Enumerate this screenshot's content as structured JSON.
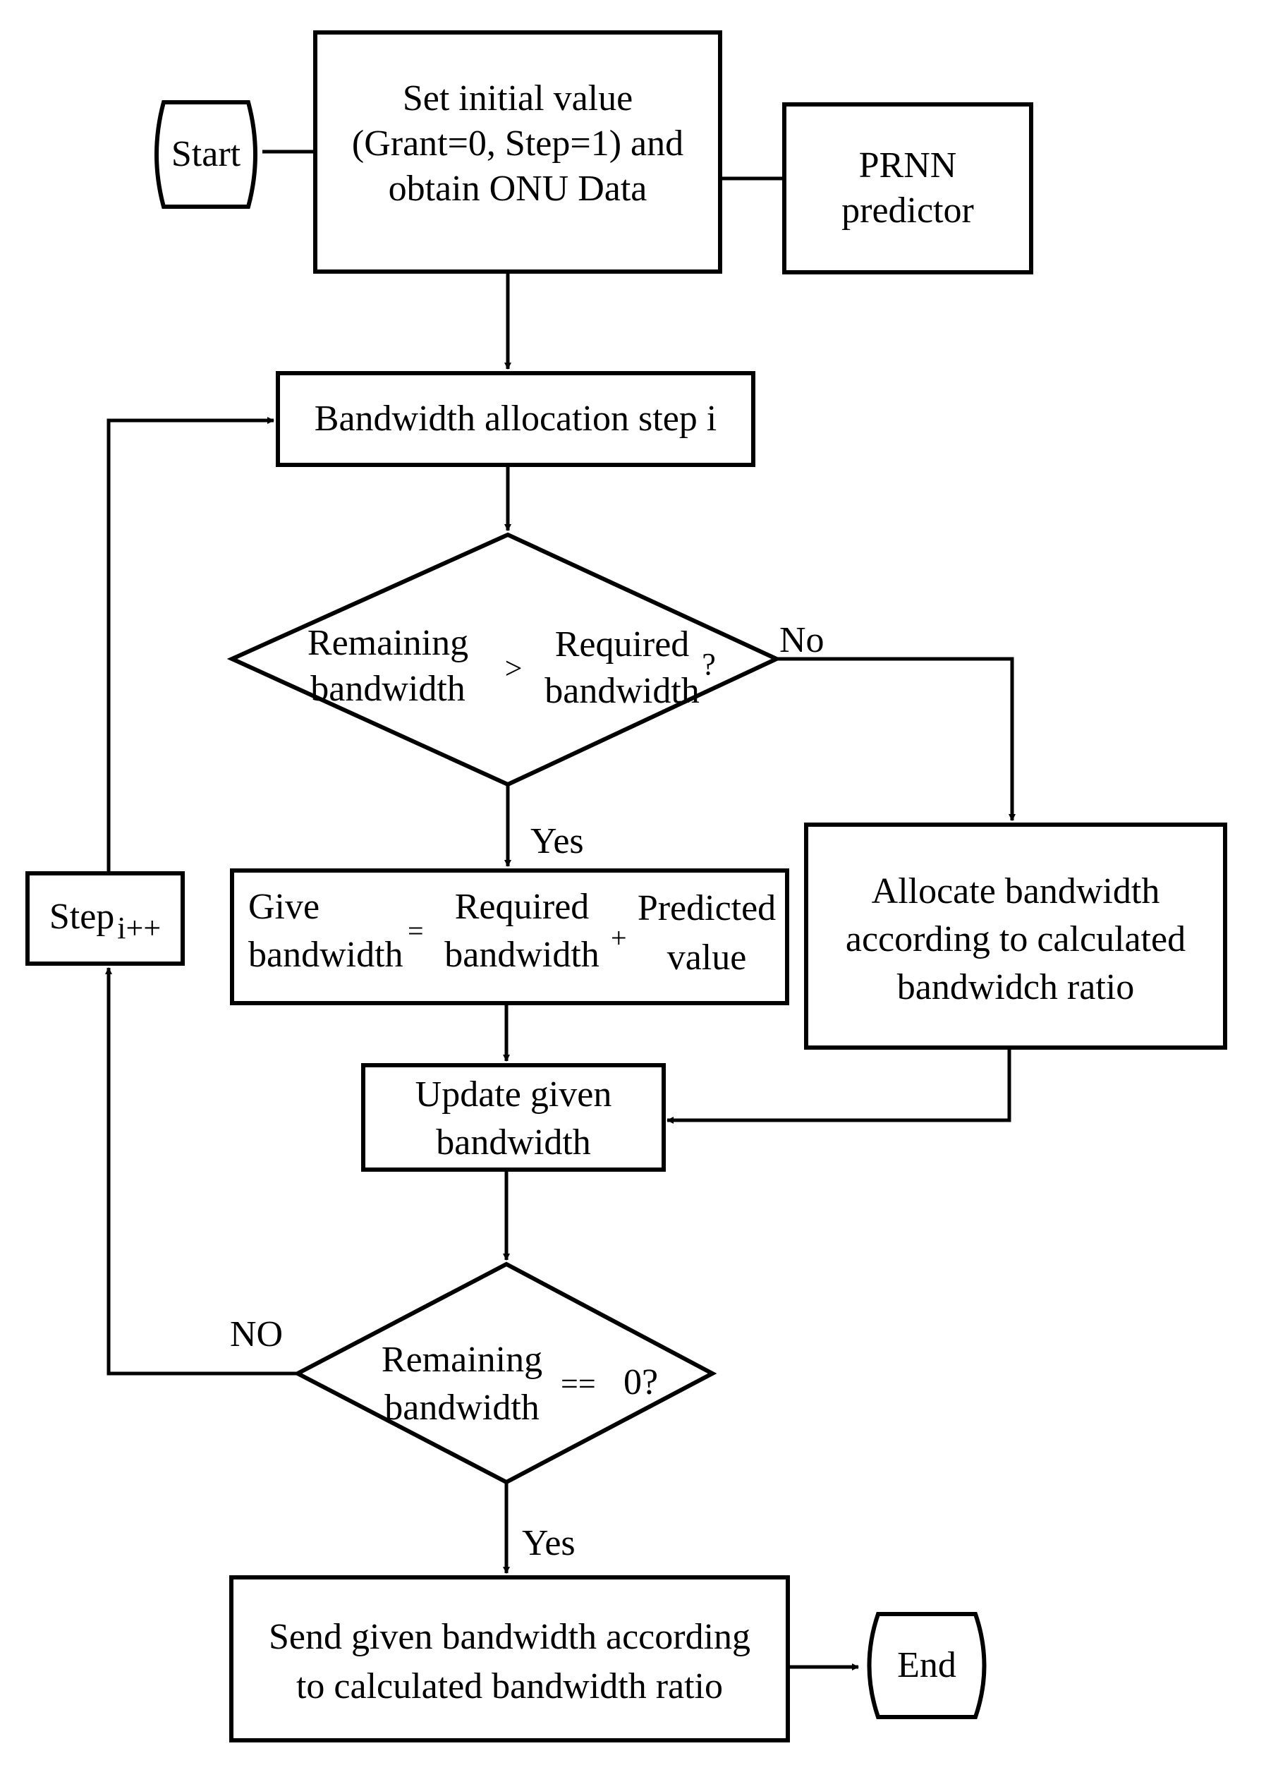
{
  "flowchart": {
    "nodes": {
      "start": {
        "label": "Start"
      },
      "init": {
        "lines": [
          "Set initial value",
          "(Grant=0, Step=1) and",
          "obtain ONU Data"
        ]
      },
      "prnn": {
        "lines": [
          "PRNN",
          "predictor"
        ]
      },
      "alloc_step": {
        "label": "Bandwidth allocation step i"
      },
      "decision1": {
        "left": [
          "Remaining",
          "bandwidth"
        ],
        "op": ">",
        "right": [
          "Required",
          "bandwidth"
        ],
        "q": "?"
      },
      "give": {
        "left": [
          "Give",
          "bandwidth"
        ],
        "eq": "=",
        "mid": [
          "Required",
          "bandwidth"
        ],
        "plus": "+",
        "right": [
          "Predicted",
          "value"
        ]
      },
      "allocate_ratio": {
        "lines": [
          "Allocate bandwidth",
          "according to calculated",
          "bandwidch ratio"
        ]
      },
      "step_inc": {
        "base": "Step",
        "sub": "i++"
      },
      "update": {
        "lines": [
          "Update given",
          "bandwidth"
        ]
      },
      "decision2": {
        "left": [
          "Remaining",
          "bandwidth"
        ],
        "op": "==",
        "right": "0?"
      },
      "send": {
        "lines": [
          "Send given bandwidth according",
          "to calculated bandwidth ratio"
        ]
      },
      "end": {
        "label": "End"
      }
    },
    "edge_labels": {
      "d1_no": "No",
      "d1_yes": "Yes",
      "d2_no": "NO",
      "d2_yes": "Yes"
    }
  }
}
